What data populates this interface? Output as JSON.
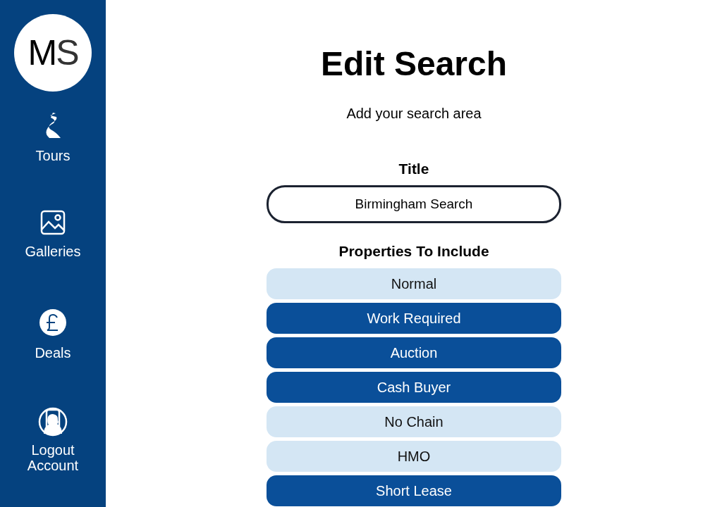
{
  "sidebar": {
    "logo": {
      "initials_bold": "M",
      "initials_light": "S"
    },
    "items": [
      {
        "label": "Tours"
      },
      {
        "label": "Galleries"
      },
      {
        "label": "Deals"
      },
      {
        "label": "Account",
        "overlay_label": "Logout"
      }
    ]
  },
  "heading": "Edit Search",
  "subheading": "Add your search area",
  "title_field": {
    "label": "Title",
    "value": "Birmingham Search"
  },
  "properties": {
    "label": "Properties To Include",
    "options": [
      {
        "label": "Normal",
        "selected": false
      },
      {
        "label": "Work Required",
        "selected": true
      },
      {
        "label": "Auction",
        "selected": true
      },
      {
        "label": "Cash Buyer",
        "selected": true
      },
      {
        "label": "No Chain",
        "selected": false
      },
      {
        "label": "HMO",
        "selected": false
      },
      {
        "label": "Short Lease",
        "selected": true
      }
    ]
  }
}
